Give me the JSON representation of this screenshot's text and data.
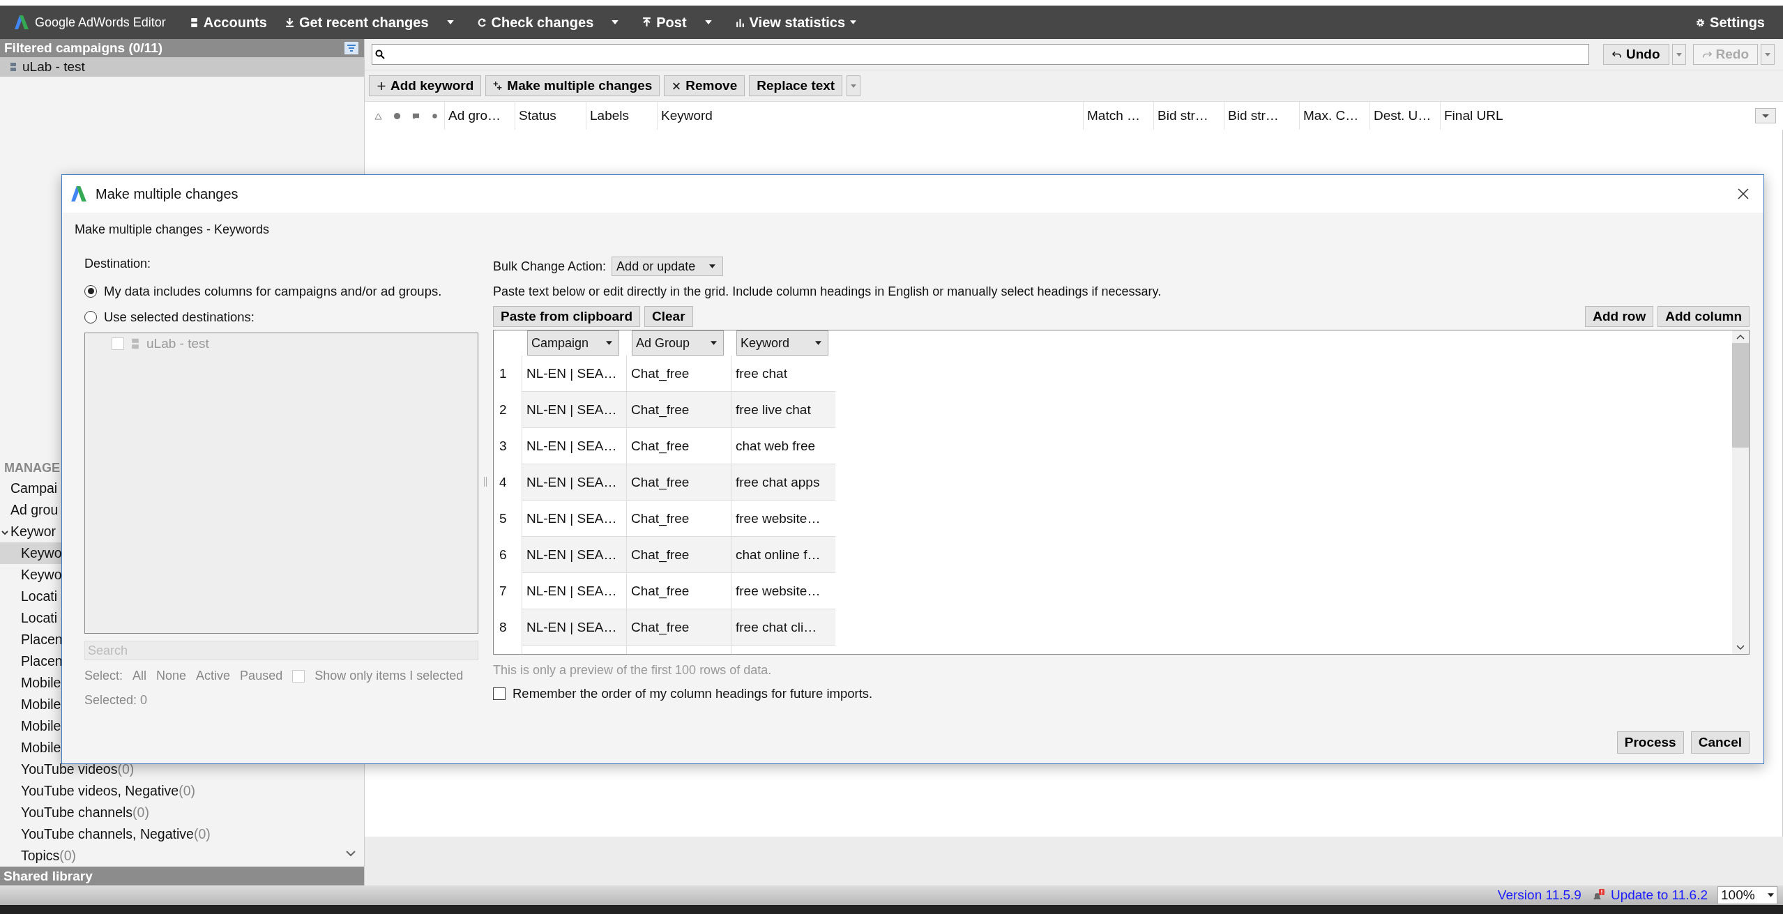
{
  "app": {
    "title": "Google AdWords Editor"
  },
  "toolbar": [
    {
      "label": "Accounts",
      "kind": "plain"
    },
    {
      "label": "Get recent changes",
      "kind": "split"
    },
    {
      "label": "Check changes",
      "kind": "split"
    },
    {
      "label": "Post",
      "kind": "split"
    },
    {
      "label": "View statistics",
      "kind": "inline"
    }
  ],
  "settings": "Settings",
  "left_panel": {
    "header": "Filtered campaigns (0/11)",
    "campaigns": [
      {
        "label": "uLab - test",
        "selected": true
      }
    ]
  },
  "manage": {
    "heading": "MANAGE",
    "items": [
      {
        "label": "Campai",
        "selected": false
      },
      {
        "label": "Ad grou",
        "selected": false
      },
      {
        "label": "Keywor",
        "selected": false,
        "expanded": true,
        "children": [
          {
            "label": "Keywo",
            "selected": true
          },
          {
            "label": "Keywo",
            "selected": false
          },
          {
            "label": "Locati",
            "selected": false
          },
          {
            "label": "Locati",
            "selected": false
          },
          {
            "label": "Placen",
            "selected": false
          },
          {
            "label": "Placen",
            "selected": false
          },
          {
            "label": "Mobile",
            "selected": false
          },
          {
            "label": "Mobile",
            "selected": false
          },
          {
            "label": "Mobile",
            "selected": false
          },
          {
            "label": "Mobile",
            "selected": false
          },
          {
            "label": "YouTube videos",
            "count": "(0)",
            "selected": false
          },
          {
            "label": "YouTube videos, Negative",
            "count": "(0)",
            "selected": false
          },
          {
            "label": "YouTube channels",
            "count": "(0)",
            "selected": false
          },
          {
            "label": "YouTube channels, Negative",
            "count": "(0)",
            "selected": false
          },
          {
            "label": "Topics",
            "count": "(0)",
            "selected": false
          }
        ]
      }
    ]
  },
  "shared_library": "Shared library",
  "history": [
    {
      "label": "Undo",
      "disabled": false
    },
    {
      "label": "Redo",
      "disabled": true
    }
  ],
  "actions": [
    {
      "label": "Add keyword",
      "kind": "plus"
    },
    {
      "label": "Make multiple changes",
      "kind": "multi"
    },
    {
      "label": "Remove",
      "kind": "remove"
    },
    {
      "label": "Replace text",
      "kind": "split"
    }
  ],
  "table": {
    "columns": [
      "Ad gro…",
      "Status",
      "Labels",
      "Keyword",
      "Match …",
      "Bid str…",
      "Bid str…",
      "Max. C…",
      "Dest. U…",
      "Final URL"
    ]
  },
  "dialog": {
    "title": "Make multiple changes",
    "subtitle": "Make multiple changes - Keywords",
    "destination_label": "Destination:",
    "options": [
      {
        "label": "My data includes columns for campaigns and/or ad groups.",
        "selected": true
      },
      {
        "label": "Use selected destinations:",
        "selected": false
      }
    ],
    "destinations": [
      {
        "label": "uLab - test",
        "checked": false
      }
    ],
    "search": {
      "placeholder": "Search"
    },
    "select_label": "Select:",
    "select_links": [
      "All",
      "None",
      "Active",
      "Paused"
    ],
    "show_only": {
      "label": "Show only items I selected",
      "checked": false
    },
    "selected_count": "Selected: 0",
    "bulk_label": "Bulk Change Action:",
    "bulk_value": "Add or update",
    "instructions": "Paste text below or edit directly in the grid. Include column headings in English or manually select headings if necessary.",
    "buttons": [
      "Paste from clipboard",
      "Clear"
    ],
    "right_buttons": [
      "Add row",
      "Add column"
    ],
    "grid": {
      "columns": [
        "Campaign",
        "Ad Group",
        "Keyword"
      ],
      "rows": [
        {
          "num": "1",
          "cells": [
            "NL-EN | SEA…",
            "Chat_free",
            "free chat"
          ]
        },
        {
          "num": "2",
          "cells": [
            "NL-EN | SEA…",
            "Chat_free",
            "free live chat"
          ]
        },
        {
          "num": "3",
          "cells": [
            "NL-EN | SEA…",
            "Chat_free",
            "chat web free"
          ]
        },
        {
          "num": "4",
          "cells": [
            "NL-EN | SEA…",
            "Chat_free",
            "free chat apps"
          ]
        },
        {
          "num": "5",
          "cells": [
            "NL-EN | SEA…",
            "Chat_free",
            "free website…"
          ]
        },
        {
          "num": "6",
          "cells": [
            "NL-EN | SEA…",
            "Chat_free",
            "chat online f…"
          ]
        },
        {
          "num": "7",
          "cells": [
            "NL-EN | SEA…",
            "Chat_free",
            "free website…"
          ]
        },
        {
          "num": "8",
          "cells": [
            "NL-EN | SEA…",
            "Chat_free",
            "free chat cli…"
          ]
        }
      ]
    },
    "preview_note": "This is only a preview of the first 100 rows of data.",
    "remember": {
      "label": "Remember the order of my column headings for future imports.",
      "checked": false
    },
    "footer_buttons": [
      "Process",
      "Cancel"
    ]
  },
  "status_bar": {
    "version": "Version 11.5.9",
    "update": "Update to 11.6.2",
    "zoom": "100%"
  }
}
